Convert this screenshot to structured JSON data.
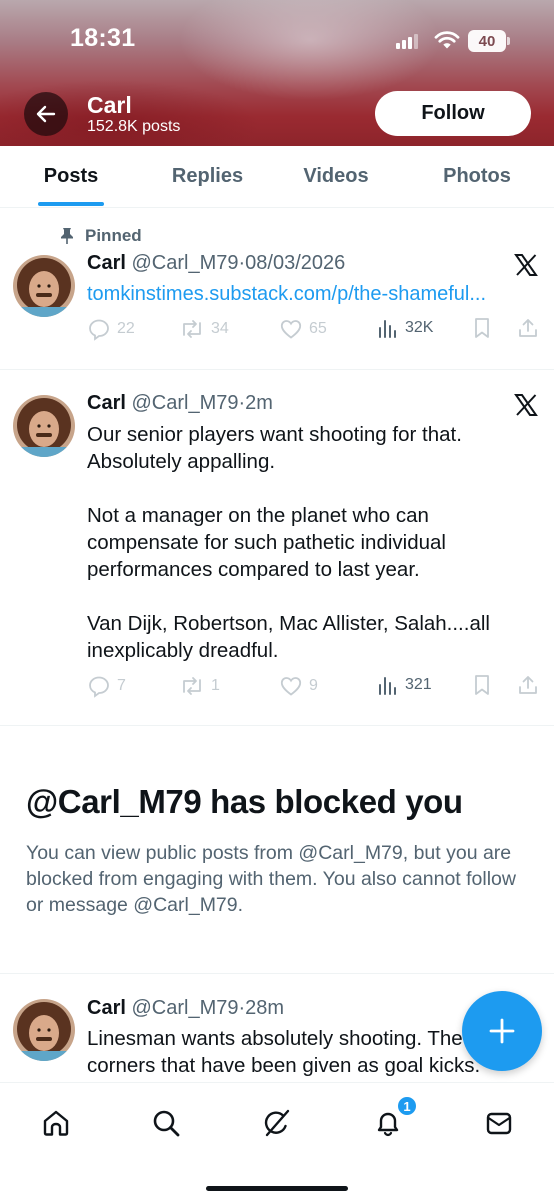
{
  "status_bar": {
    "time": "18:31",
    "battery": "40"
  },
  "profile_header": {
    "name": "Carl",
    "post_count": "152.8K posts",
    "follow_label": "Follow"
  },
  "tabs": [
    {
      "label": "Posts",
      "active": true
    },
    {
      "label": "Replies",
      "active": false
    },
    {
      "label": "Videos",
      "active": false
    },
    {
      "label": "Photos",
      "active": false
    }
  ],
  "posts": [
    {
      "pinned_label": "Pinned",
      "name": "Carl",
      "handle": "@Carl_M79",
      "separator": "·",
      "time": "08/03/2026",
      "link": "tomkinstimes.substack.com/p/the-shameful...",
      "replies": "22",
      "reposts": "34",
      "likes": "65",
      "views": "32K"
    },
    {
      "name": "Carl",
      "handle": "@Carl_M79",
      "separator": "·",
      "time": "2m",
      "paragraphs": [
        "Our senior players want shooting for that. Absolutely appalling.",
        "Not a manager on the planet who can compensate for such pathetic individual performances compared to last year.",
        "Van Dijk, Robertson, Mac Allister, Salah....all inexplicably dreadful."
      ],
      "replies": "7",
      "reposts": "1",
      "likes": "9",
      "views": "321"
    },
    {
      "name": "Carl",
      "handle": "@Carl_M79",
      "separator": "·",
      "time": "28m",
      "text": "Linesman wants absolutely shooting.  The corners that have been given as goal kicks."
    }
  ],
  "blocked_notice": {
    "title": "@Carl_M79 has blocked you",
    "body": "You can view public posts from @Carl_M79, but you are blocked from engaging with them. You also cannot follow or message @Carl_M79."
  },
  "bottom_nav": {
    "items": [
      "home-icon",
      "search-icon",
      "grok-icon",
      "notifications-icon",
      "messages-icon"
    ],
    "notification_count": "1"
  },
  "colors": {
    "accent": "#1d9bf0",
    "text": "#0f1419",
    "secondary": "#536471",
    "disabled": "#c5ccd1"
  }
}
